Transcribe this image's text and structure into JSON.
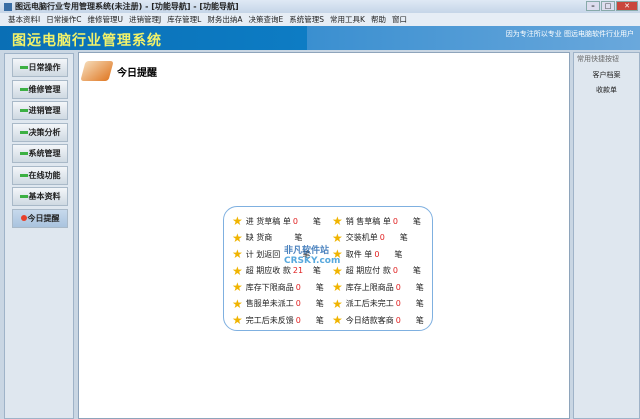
{
  "window": {
    "title": "图远电脑行业专用管理系统(未注册) - [功能导航] - [功能导航]"
  },
  "menu": [
    "基本资料I",
    "日常操作C",
    "维修管理U",
    "进销管理J",
    "库存管理L",
    "财务出纳A",
    "决策查询E",
    "系统管理S",
    "常用工具K",
    "帮助",
    "窗口"
  ],
  "banner": {
    "title": "图远电脑行业管理系统",
    "slogan": "因为专注所以专业  图远电脑软件行业用户"
  },
  "sidebar": [
    {
      "label": "日常操作",
      "icon": "dash"
    },
    {
      "label": "维修管理",
      "icon": "dash"
    },
    {
      "label": "进销管理",
      "icon": "dash"
    },
    {
      "label": "决策分析",
      "icon": "dash"
    },
    {
      "label": "系统管理",
      "icon": "dash"
    },
    {
      "label": "在线功能",
      "icon": "dash"
    },
    {
      "label": "基本资料",
      "icon": "dash"
    },
    {
      "label": "今日提醒",
      "icon": "dot",
      "active": true
    }
  ],
  "content": {
    "title": "今日提醒",
    "unit": "笔",
    "left": [
      {
        "label": "进 货草稿 单",
        "value": "0"
      },
      {
        "label": "缺  货商",
        "value": ""
      },
      {
        "label": "计 划返回",
        "value": ""
      },
      {
        "label": "超 期应收 款",
        "value": "21"
      },
      {
        "label": "库存下限商品",
        "value": "0"
      },
      {
        "label": "售服单未派工",
        "value": "0"
      },
      {
        "label": "完工后未反馈",
        "value": "0"
      }
    ],
    "right": [
      {
        "label": "销 售草稿 单",
        "value": "0"
      },
      {
        "label": "交装机单",
        "value": "0"
      },
      {
        "label": "取件 单",
        "value": "0"
      },
      {
        "label": "超 期应付 款",
        "value": "0"
      },
      {
        "label": "库存上限商品",
        "value": "0"
      },
      {
        "label": "派工后未完工",
        "value": "0"
      },
      {
        "label": "今日结款客商",
        "value": "0"
      }
    ],
    "watermark": [
      "非凡软件站",
      "CRSKY.com"
    ]
  },
  "rightpanel": {
    "header": "常用快捷按钮",
    "items": [
      "客户档案",
      "收款单"
    ]
  }
}
